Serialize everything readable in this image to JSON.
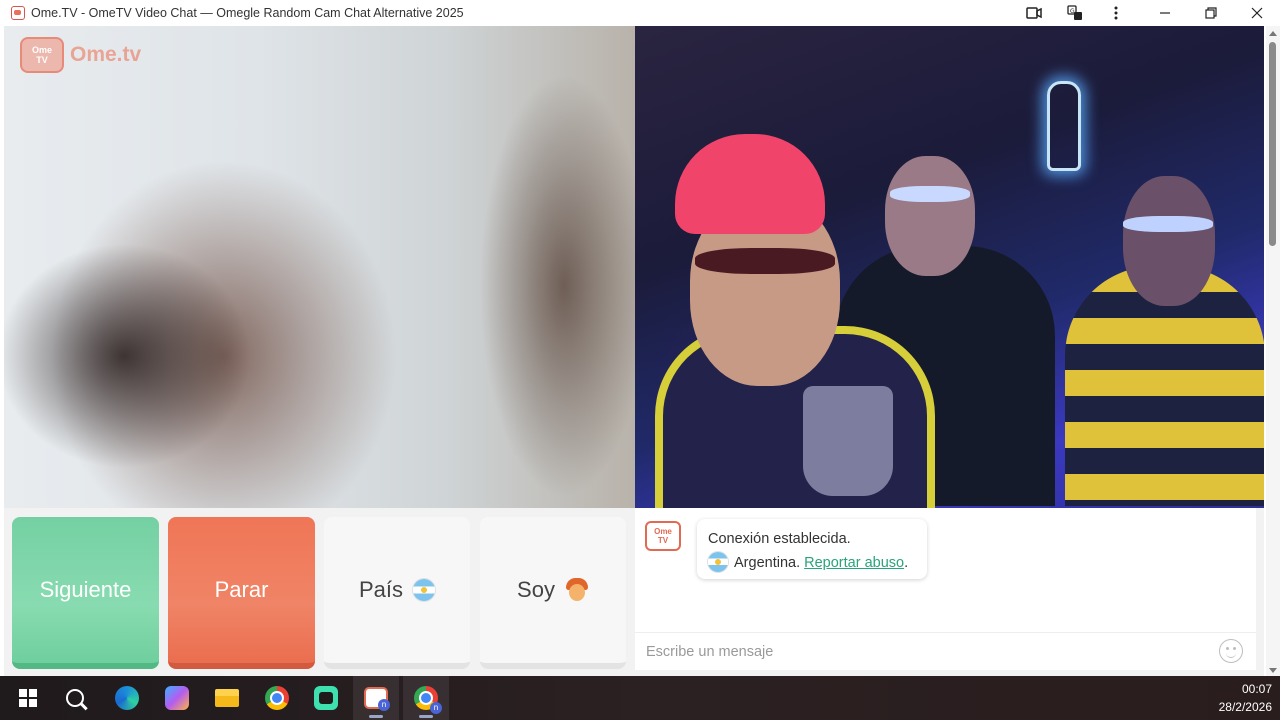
{
  "window": {
    "title": "Ome.TV - OmeTV Video Chat — Omegle Random Cam Chat Alternative 2025",
    "icons": [
      "camera-icon",
      "translate-icon",
      "more-options-icon"
    ],
    "controls": [
      "minimize-icon",
      "restore-icon",
      "close-icon"
    ]
  },
  "logo": {
    "badge_line1": "Ome",
    "badge_line2": "TV",
    "text": "Ome.tv"
  },
  "controls": {
    "next_label": "Siguiente",
    "stop_label": "Parar",
    "country_label": "País",
    "gender_label": "Soy"
  },
  "chat": {
    "logo_line1": "Ome",
    "logo_line2": "TV",
    "status": "Conexión establecida.",
    "country": "Argentina.",
    "report_link": "Reportar abuso",
    "report_suffix": ".",
    "input_placeholder": "Escribe un mensaje"
  },
  "colors": {
    "next_button": "#74d0a2",
    "stop_button": "#ef7656",
    "link": "#2aa37a",
    "brand": "#e26a52"
  },
  "taskbar": {
    "apps": [
      "windows-start-icon",
      "search-icon",
      "edge-icon",
      "copilot-icon",
      "file-explorer-icon",
      "chrome-icon",
      "chat-app-icon",
      "ometv-app-icon",
      "chrome-profile-icon"
    ],
    "time": "00:07",
    "date": "28/2/2026"
  }
}
